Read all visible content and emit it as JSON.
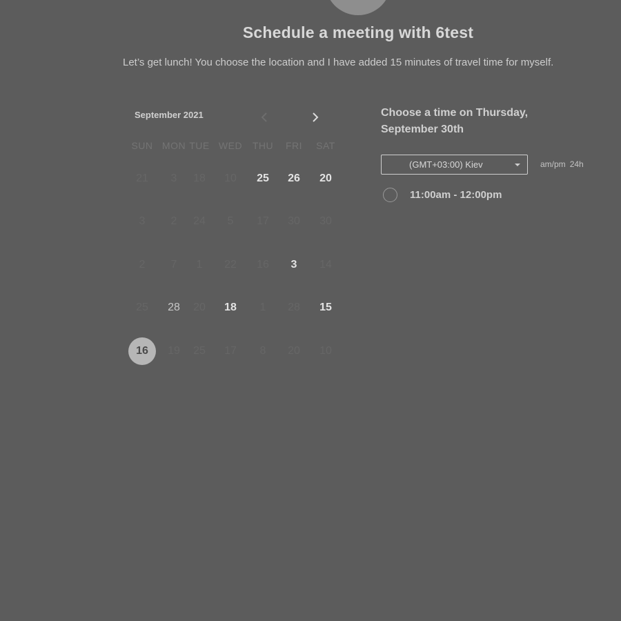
{
  "header": {
    "title": "Schedule a meeting with 6test",
    "description": "Let’s get lunch! You choose the location and I have added 15 minutes of travel time for myself."
  },
  "calendar": {
    "month_label": "September 2021",
    "prev_icon": "chevron-left-icon",
    "next_icon": "chevron-right-icon",
    "weekdays": [
      "SUN",
      "MON",
      "TUE",
      "WED",
      "THU",
      "FRI",
      "SAT"
    ],
    "weeks": [
      [
        {
          "label": "21",
          "state": "disabled"
        },
        {
          "label": "3",
          "state": "disabled"
        },
        {
          "label": "18",
          "state": "disabled"
        },
        {
          "label": "10",
          "state": "disabled"
        },
        {
          "label": "25",
          "state": "enabled"
        },
        {
          "label": "26",
          "state": "enabled"
        },
        {
          "label": "20",
          "state": "enabled"
        }
      ],
      [
        {
          "label": "3",
          "state": "disabled"
        },
        {
          "label": "2",
          "state": "disabled"
        },
        {
          "label": "24",
          "state": "disabled"
        },
        {
          "label": "5",
          "state": "disabled"
        },
        {
          "label": "17",
          "state": "disabled"
        },
        {
          "label": "30",
          "state": "disabled"
        },
        {
          "label": "30",
          "state": "disabled"
        }
      ],
      [
        {
          "label": "2",
          "state": "disabled"
        },
        {
          "label": "7",
          "state": "disabled"
        },
        {
          "label": "1",
          "state": "disabled"
        },
        {
          "label": "22",
          "state": "disabled"
        },
        {
          "label": "16",
          "state": "disabled"
        },
        {
          "label": "3",
          "state": "enabled"
        },
        {
          "label": "14",
          "state": "disabled"
        }
      ],
      [
        {
          "label": "25",
          "state": "disabled"
        },
        {
          "label": "28",
          "state": "enabled-light"
        },
        {
          "label": "20",
          "state": "disabled"
        },
        {
          "label": "18",
          "state": "enabled"
        },
        {
          "label": "1",
          "state": "disabled"
        },
        {
          "label": "28",
          "state": "disabled"
        },
        {
          "label": "15",
          "state": "enabled"
        }
      ],
      [
        {
          "label": "16",
          "state": "selected"
        },
        {
          "label": "19",
          "state": "disabled"
        },
        {
          "label": "25",
          "state": "disabled"
        },
        {
          "label": "17",
          "state": "disabled"
        },
        {
          "label": "8",
          "state": "disabled"
        },
        {
          "label": "20",
          "state": "disabled"
        },
        {
          "label": "10",
          "state": "disabled"
        }
      ]
    ]
  },
  "times": {
    "heading": "Choose a time on Thursday, September 30th",
    "timezone": "(GMT+03:00) Kiev",
    "format_12h": "am/pm",
    "format_24h": "24h",
    "slots": [
      {
        "label": "11:00am - 12:00pm"
      }
    ]
  },
  "colors": {
    "overlay_background": "#5c5c5c",
    "selected_day": "#b6b6b6"
  }
}
